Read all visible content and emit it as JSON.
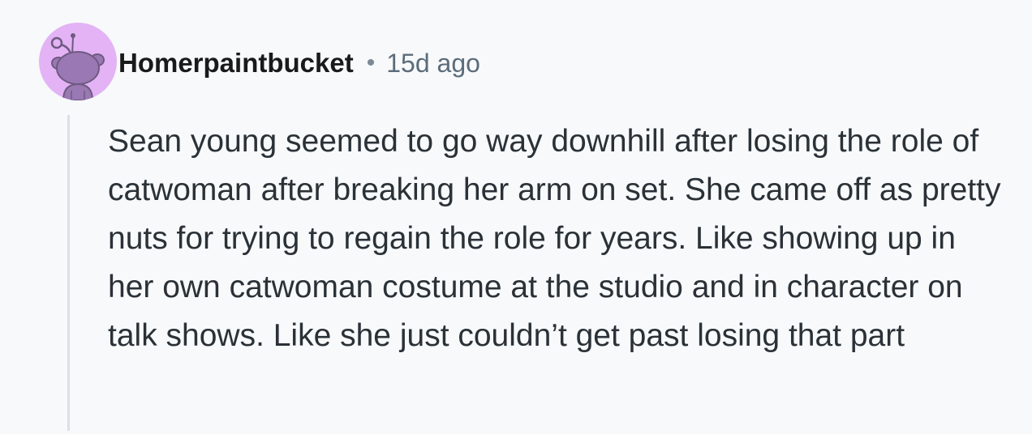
{
  "comment": {
    "username": "Homerpaintbucket",
    "separator": "•",
    "timestamp": "15d ago",
    "avatar_icon": "snoo-avatar-icon",
    "avatar_color": "#e3b3f5",
    "body": "Sean young seemed to go way downhill after losing the role of catwoman after breaking her arm on set. She came off as pretty nuts for trying to regain the role for years. Like showing up in her own catwoman costume at the studio and in character on talk shows. Like she just couldn’t get past losing that part"
  }
}
